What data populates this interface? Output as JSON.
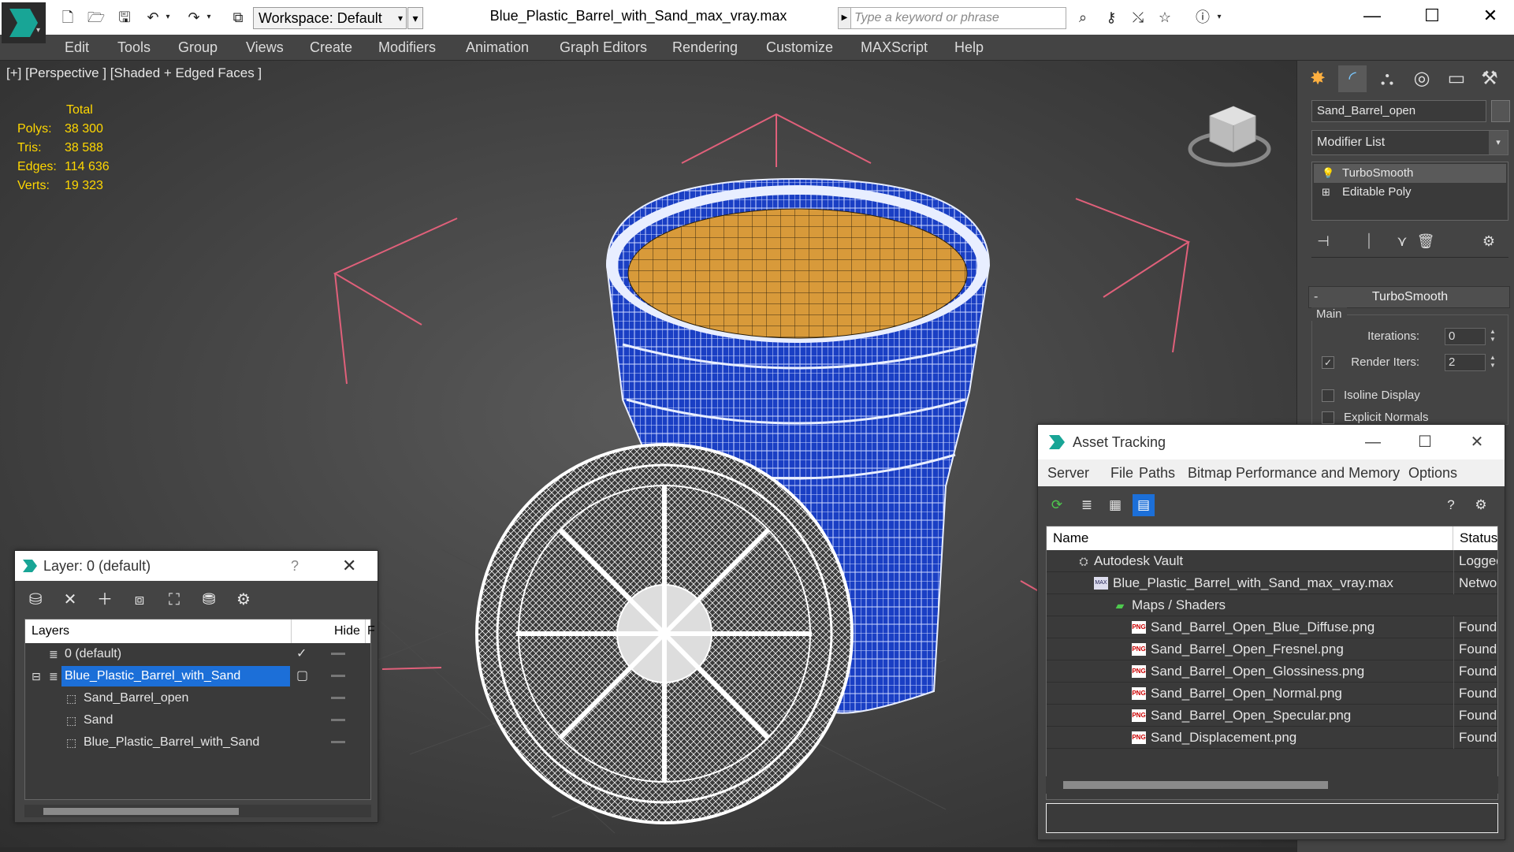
{
  "app": {
    "doc_title": "Blue_Plastic_Barrel_with_Sand_max_vray.max",
    "workspace": "Workspace: Default",
    "search_placeholder": "Type a keyword or phrase"
  },
  "menu": [
    "Edit",
    "Tools",
    "Group",
    "Views",
    "Create",
    "Modifiers",
    "Animation",
    "Graph Editors",
    "Rendering",
    "Customize",
    "MAXScript",
    "Help"
  ],
  "viewport": {
    "label": "[+] [Perspective ] [Shaded + Edged Faces ]",
    "stats_header": "Total",
    "stats": [
      {
        "key": "Polys:",
        "value": "38 300"
      },
      {
        "key": "Tris:",
        "value": "38 588"
      },
      {
        "key": "Edges:",
        "value": "114 636"
      },
      {
        "key": "Verts:",
        "value": "19 323"
      }
    ]
  },
  "command_panel": {
    "object_name": "Sand_Barrel_open",
    "modifier_list": "Modifier List",
    "stack": [
      "TurboSmooth",
      "Editable Poly"
    ],
    "rollout_title": "TurboSmooth",
    "group_main": "Main",
    "iterations_label": "Iterations:",
    "iterations_value": "0",
    "render_iters_label": "Render Iters:",
    "render_iters_value": "2",
    "isoline_label": "Isoline Display",
    "explicit_normals_label": "Explicit Normals"
  },
  "layer_dialog": {
    "title": "Layer: 0 (default)",
    "help": "?",
    "col_layers": "Layers",
    "col_hide": "Hide",
    "col_f": "F",
    "rows": [
      {
        "name": "0 (default)",
        "indent": 0,
        "type": "layer",
        "current": true,
        "selected": false
      },
      {
        "name": "Blue_Plastic_Barrel_with_Sand",
        "indent": 0,
        "type": "layer",
        "current": false,
        "selected": true
      },
      {
        "name": "Sand_Barrel_open",
        "indent": 1,
        "type": "object",
        "current": false,
        "selected": false
      },
      {
        "name": "Sand",
        "indent": 1,
        "type": "object",
        "current": false,
        "selected": false
      },
      {
        "name": "Blue_Plastic_Barrel_with_Sand",
        "indent": 1,
        "type": "object",
        "current": false,
        "selected": false
      }
    ]
  },
  "asset_dialog": {
    "title": "Asset Tracking",
    "menu": [
      "Server",
      "File",
      "Paths",
      "Bitmap Performance and Memory",
      "Options"
    ],
    "col_name": "Name",
    "col_status": "Status",
    "rows": [
      {
        "name": "Autodesk Vault",
        "indent": 0,
        "icon": "vault",
        "status": "Logged"
      },
      {
        "name": "Blue_Plastic_Barrel_with_Sand_max_vray.max",
        "indent": 1,
        "icon": "max",
        "status": "Networ"
      },
      {
        "name": "Maps / Shaders",
        "indent": 2,
        "icon": "maps",
        "status": ""
      },
      {
        "name": "Sand_Barrel_Open_Blue_Diffuse.png",
        "indent": 3,
        "icon": "png",
        "status": "Found"
      },
      {
        "name": "Sand_Barrel_Open_Fresnel.png",
        "indent": 3,
        "icon": "png",
        "status": "Found"
      },
      {
        "name": "Sand_Barrel_Open_Glossiness.png",
        "indent": 3,
        "icon": "png",
        "status": "Found"
      },
      {
        "name": "Sand_Barrel_Open_Normal.png",
        "indent": 3,
        "icon": "png",
        "status": "Found"
      },
      {
        "name": "Sand_Barrel_Open_Specular.png",
        "indent": 3,
        "icon": "png",
        "status": "Found"
      },
      {
        "name": "Sand_Displacement.png",
        "indent": 3,
        "icon": "png",
        "status": "Found"
      }
    ]
  },
  "colors": {
    "accent": "#1c6fd8",
    "barrel": "#1a3fc4",
    "sand": "#d89a3a",
    "stats": "#ffd700",
    "gizmo": "#e0607a"
  }
}
